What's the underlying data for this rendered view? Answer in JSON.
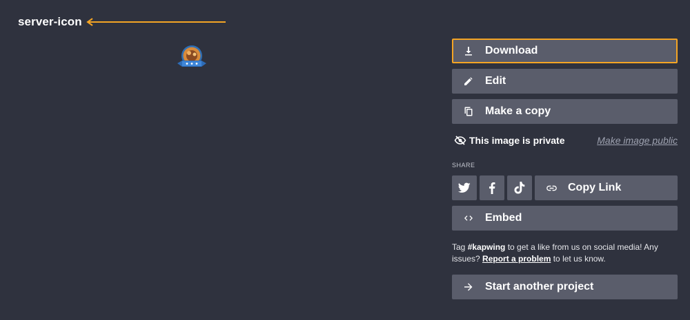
{
  "header": {
    "file_title": "server-icon"
  },
  "colors": {
    "background": "#2f323e",
    "button": "#5a5d6b",
    "accent": "#f5a524",
    "muted_link": "#9ea2b0"
  },
  "actions": {
    "download_label": "Download",
    "edit_label": "Edit",
    "copy_label": "Make a copy"
  },
  "privacy": {
    "status_text": "This image is private",
    "make_public_label": "Make image public"
  },
  "share": {
    "section_label": "SHARE",
    "copy_link_label": "Copy Link",
    "embed_label": "Embed",
    "icons": [
      "twitter-icon",
      "facebook-icon",
      "tiktok-icon",
      "link-icon",
      "code-icon"
    ]
  },
  "footer_note": {
    "prefix": "Tag ",
    "hashtag": "#kapwing",
    "middle": " to get a like from us on social media! Any issues? ",
    "report_link": "Report a problem",
    "suffix": " to let us know."
  },
  "cta": {
    "start_label": "Start another project"
  }
}
